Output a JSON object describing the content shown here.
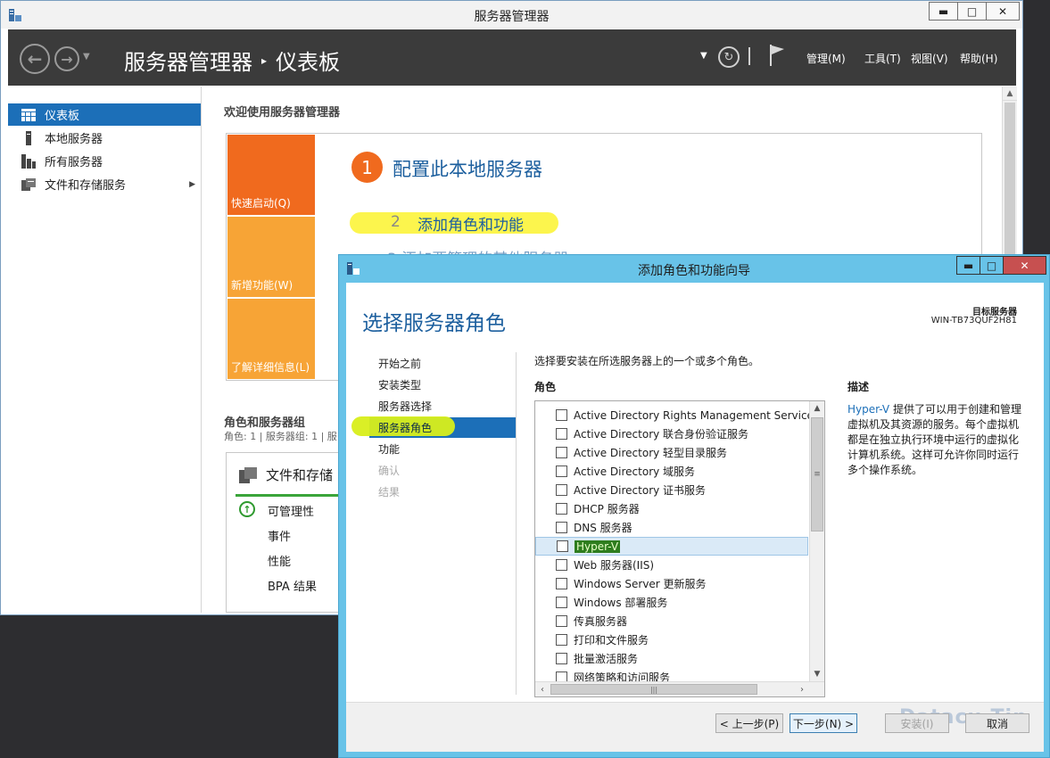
{
  "server_manager": {
    "window_title": "服务器管理器",
    "controls": {
      "minimize": "▬",
      "maximize": "□",
      "close": "✕"
    },
    "breadcrumb": {
      "root": "服务器管理器",
      "separator": "▸",
      "current": "仪表板"
    },
    "menus": {
      "manage": "管理(M)",
      "tools": "工具(T)",
      "view": "视图(V)",
      "help": "帮助(H)"
    },
    "sidebar": {
      "items": [
        {
          "label": "仪表板",
          "icon": "dashboard-icon"
        },
        {
          "label": "本地服务器",
          "icon": "local-server-icon"
        },
        {
          "label": "所有服务器",
          "icon": "all-servers-icon"
        },
        {
          "label": "文件和存储服务",
          "icon": "file-storage-icon"
        }
      ]
    },
    "welcome": {
      "title": "欢迎使用服务器管理器",
      "tiles": {
        "quick_start": "快速启动(Q)",
        "new_features": "新增功能(W)",
        "learn_more": "了解详细信息(L)"
      },
      "step1": {
        "number": "1",
        "label": "配置此本地服务器"
      },
      "step2": {
        "number": "2",
        "label": "添加角色和功能"
      },
      "step3_partial": "3   添加要管理的其他服务器"
    },
    "roles_groups": {
      "title": "角色和服务器组",
      "subtitle": "角色: 1 | 服务器组: 1 | 服",
      "card": {
        "title": "文件和存储",
        "rows": {
          "manageability": "可管理性",
          "events": "事件",
          "performance": "性能",
          "bpa": "BPA 结果"
        }
      }
    }
  },
  "wizard": {
    "title": "添加角色和功能向导",
    "controls": {
      "minimize": "▬",
      "maximize": "□",
      "close": "✕"
    },
    "heading": "选择服务器角色",
    "target_label": "目标服务器",
    "target_value": "WIN-TB73QUF2H81",
    "nav": {
      "before_begin": "开始之前",
      "install_type": "安装类型",
      "server_selection": "服务器选择",
      "server_roles": "服务器角色",
      "features": "功能",
      "confirmation": "确认",
      "results": "结果"
    },
    "instruction": "选择要安装在所选服务器上的一个或多个角色。",
    "roles_header": "角色",
    "roles": [
      "Active Directory Rights Management Services",
      "Active Directory 联合身份验证服务",
      "Active Directory 轻型目录服务",
      "Active Directory 域服务",
      "Active Directory 证书服务",
      "DHCP 服务器",
      "DNS 服务器",
      "Hyper-V",
      "Web 服务器(IIS)",
      "Windows Server 更新服务",
      "Windows 部署服务",
      "传真服务器",
      "打印和文件服务",
      "批量激活服务",
      "网络策略和访问服务"
    ],
    "description": {
      "header": "描述",
      "link": "Hyper-V",
      "text": " 提供了可以用于创建和管理虚拟机及其资源的服务。每个虚拟机都是在独立执行环境中运行的虚拟化计算机系统。这样可允许你同时运行多个操作系统。"
    },
    "buttons": {
      "previous": "< 上一步(P)",
      "next": "下一步(N) >",
      "install": "安装(I)",
      "cancel": "取消"
    },
    "watermark": "Datacu.Tip"
  }
}
